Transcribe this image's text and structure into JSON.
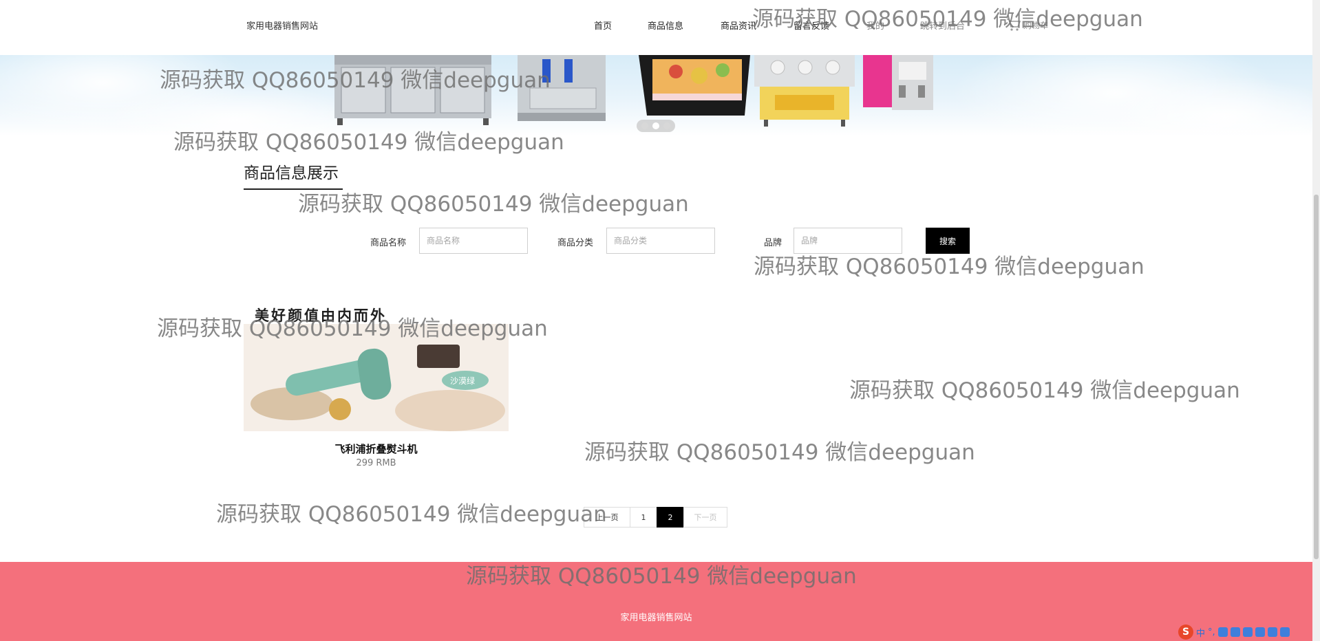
{
  "header": {
    "site_name": "家用电器销售网站",
    "nav": [
      {
        "label": "首页",
        "key": "home"
      },
      {
        "label": "商品信息",
        "key": "product-info"
      },
      {
        "label": "商品资讯",
        "key": "product-news"
      },
      {
        "label": "留言反馈",
        "key": "feedback"
      },
      {
        "label": "我的",
        "key": "mine"
      },
      {
        "label": "跳转到后台",
        "key": "admin"
      }
    ],
    "cart_label": "购物车"
  },
  "carousel": {
    "slide_count": 3,
    "active_index": 1
  },
  "section": {
    "title": "商品信息展示"
  },
  "search": {
    "name_label": "商品名称",
    "name_placeholder": "商品名称",
    "category_label": "商品分类",
    "category_placeholder": "商品分类",
    "brand_label": "品牌",
    "brand_placeholder": "品牌",
    "button_label": "搜索"
  },
  "products": [
    {
      "name": "飞利浦折叠熨斗机",
      "price": "299 RMB",
      "image_caption": "美好颜值由内而外",
      "image_badge": "沙漠绿"
    }
  ],
  "pagination": {
    "prev_label": "上一页",
    "pages": [
      "1",
      "2"
    ],
    "current_page": "2",
    "next_label": "下一页"
  },
  "footer": {
    "text": "家用电器销售网站"
  },
  "watermark": {
    "text": "源码获取 QQ86050149 微信deepguan"
  },
  "ime": {
    "chars": [
      "中",
      "°,"
    ]
  },
  "colors": {
    "footer_bg": "#f4707c",
    "search_button_bg": "#000000",
    "active_page_bg": "#000000"
  }
}
